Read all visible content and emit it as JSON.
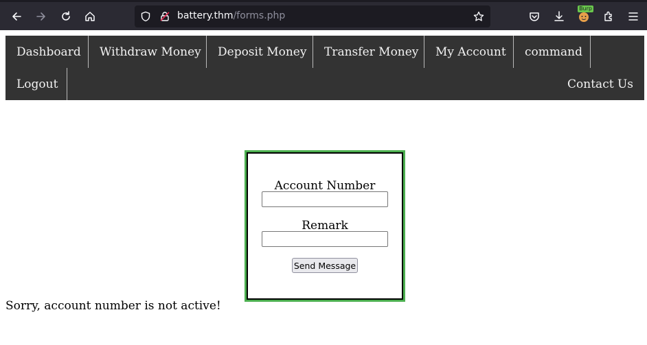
{
  "browser": {
    "url_host": "battery.thm",
    "url_path": "/forms.php",
    "burp_badge": "Burp",
    "icons": [
      "back-icon",
      "forward-icon",
      "reload-icon",
      "home-icon",
      "shield-icon",
      "lock-icon",
      "star-icon",
      "pocket-icon",
      "download-icon",
      "burp-extension-icon",
      "extensions-icon",
      "menu-icon"
    ]
  },
  "nav": {
    "dashboard": "Dashboard",
    "withdraw": "Withdraw Money",
    "deposit": "Deposit Money",
    "transfer": "Transfer Money",
    "account": "My Account",
    "command": "command",
    "logout": "Logout",
    "contact": "Contact Us"
  },
  "form": {
    "account_label": "Account Number",
    "account_value": "",
    "remark_label": "Remark",
    "remark_value": "",
    "submit_label": "Send Message"
  },
  "message": "Sorry, account number is not active!",
  "colors": {
    "nav_bg": "#333333",
    "form_border": "#4caf50",
    "chrome_bg": "#2b2a33"
  }
}
